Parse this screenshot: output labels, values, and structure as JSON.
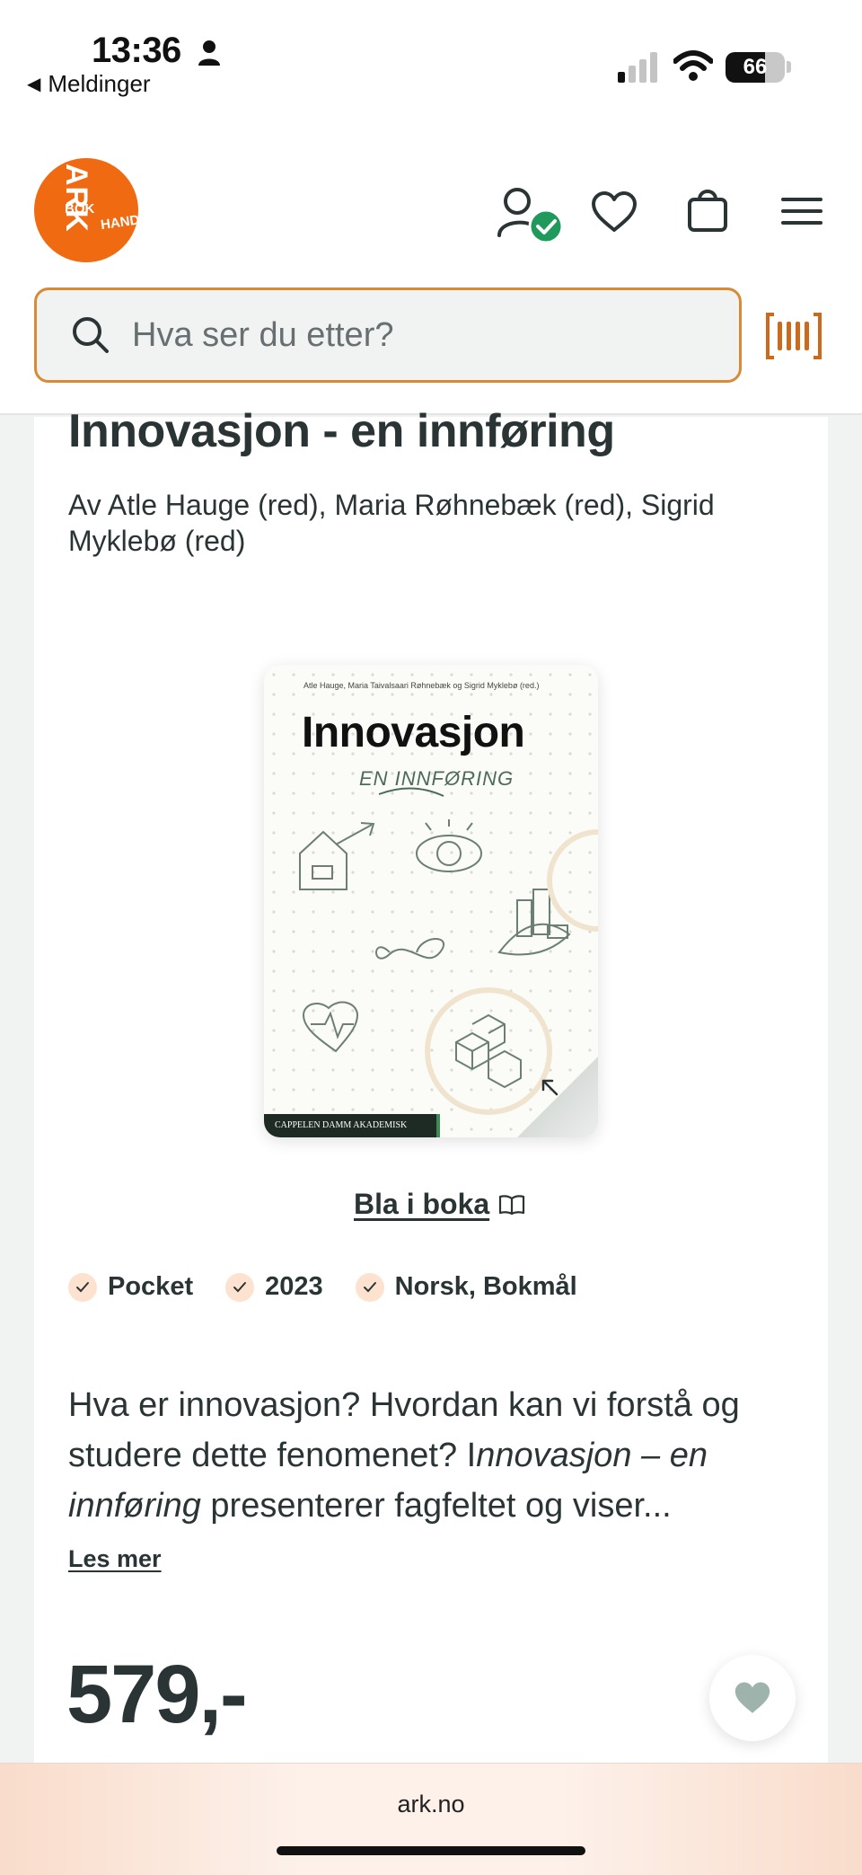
{
  "status_bar": {
    "time": "13:36",
    "back_label": "Meldinger",
    "battery": "66",
    "battery_level": 0.66
  },
  "header": {
    "logo": {
      "word1": "ARK",
      "word2": "BOK",
      "word3": "HANDEL"
    },
    "icons": [
      "account-verified-icon",
      "heart-icon",
      "bag-icon",
      "menu-icon"
    ],
    "search": {
      "placeholder": "Hva ser du etter?"
    },
    "scanner_icon": "barcode-scanner-icon",
    "accent_color": "#f06a12",
    "verified_color": "#1f9a5a"
  },
  "product": {
    "title": "Innovasjon - en innføring",
    "authors": "Av Atle Hauge (red), Maria Røhnebæk (red), Sigrid Myklebø (red)",
    "cover": {
      "authors": "Atle Hauge, Maria Taivalsaari Røhnebæk og Sigrid Myklebø (red.)",
      "title": "Innovasjon",
      "subtitle": "EN INNFØRING",
      "publisher": "CAPPELEN DAMM AKADEMISK"
    },
    "browse_label": "Bla i boka",
    "tags": [
      "Pocket",
      "2023",
      "Norsk, Bokmål"
    ],
    "description": {
      "part1": "Hva er innovasjon? Hvordan kan vi forstå og studere dette fenomenet? I",
      "italic": "nnovasjon – en innføring",
      "part2": " presenterer fagfeltet og viser..."
    },
    "read_more": "Les mer",
    "price": "579,-"
  },
  "browser": {
    "url": "ark.no"
  }
}
